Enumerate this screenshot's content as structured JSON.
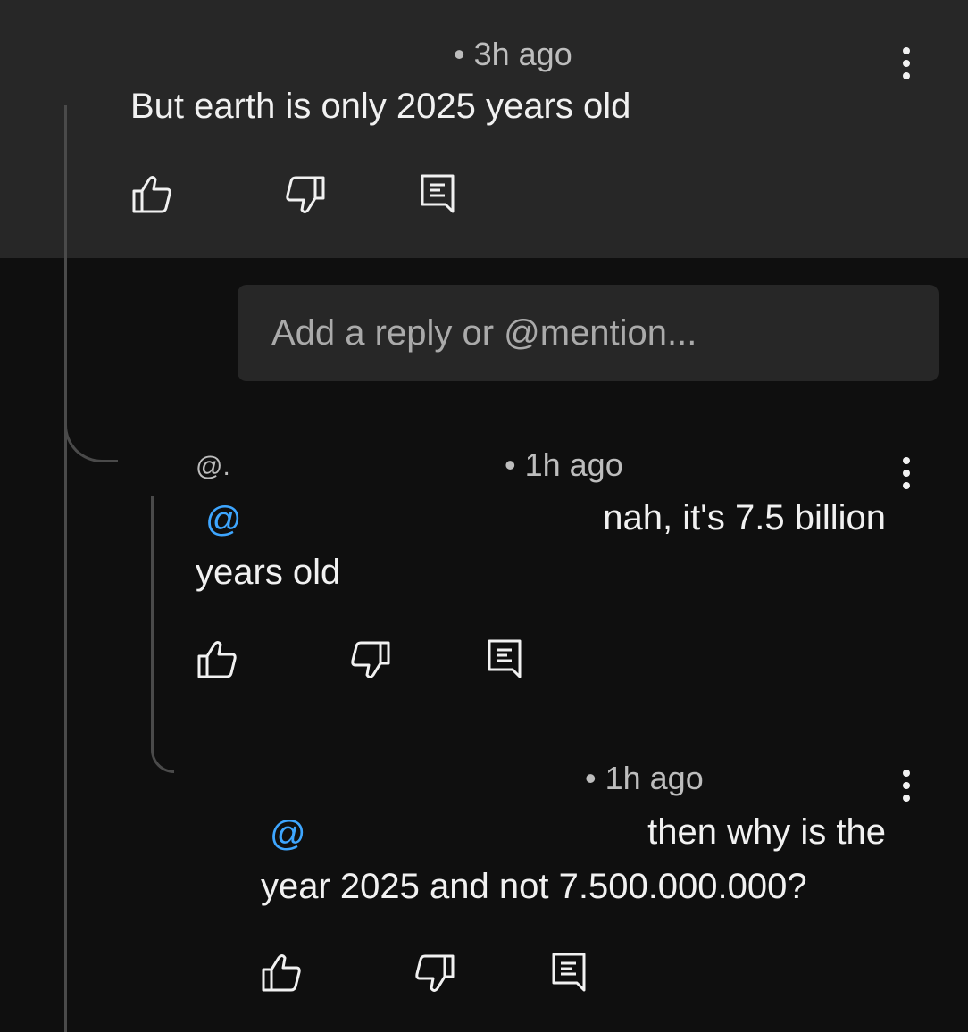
{
  "comment": {
    "time": "• 3h ago",
    "text": "But earth is only 2025 years old"
  },
  "reply_input": {
    "placeholder": "Add a reply or @mention..."
  },
  "reply1": {
    "handle": "@.",
    "time": "• 1h ago",
    "mention": "@",
    "text_line1": "nah, it's 7.5 billion",
    "text_line2": "years old"
  },
  "reply2": {
    "time": "• 1h ago",
    "mention": "@",
    "text_line1": "then why is the",
    "text_line2": "year 2025 and not 7.500.000.000?"
  },
  "icons": {
    "like": "thumbs-up-icon",
    "dislike": "thumbs-down-icon",
    "reply": "reply-icon",
    "more": "more-vert-icon"
  },
  "colors": {
    "background": "#0f0f0f",
    "highlight_band": "#272727",
    "mention": "#3ea6ff",
    "text": "#f1f1f1",
    "meta_text": "#bdbdbd"
  }
}
